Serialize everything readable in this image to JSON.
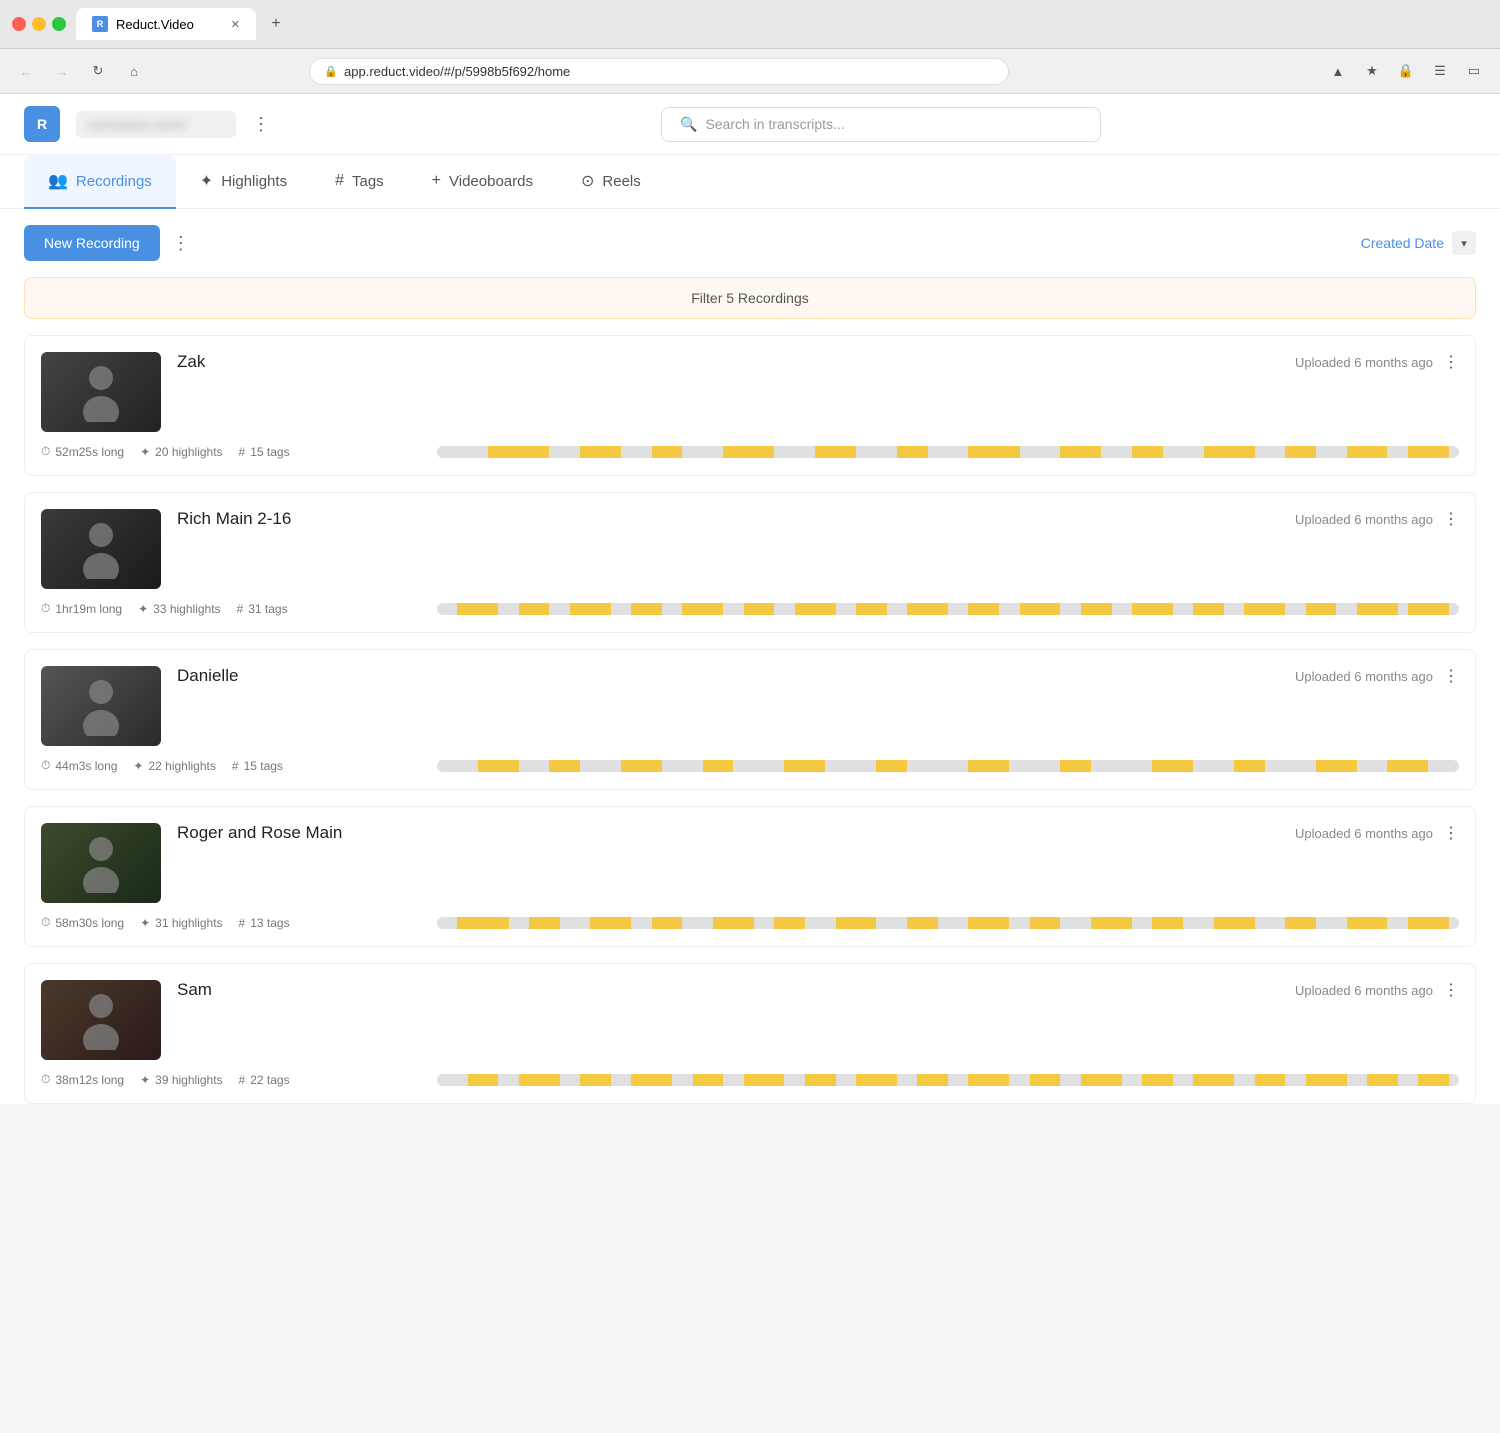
{
  "browser": {
    "url": "app.reduct.video/#/p/5998b5f692/home",
    "tab_title": "Reduct.Video",
    "new_tab_icon": "+"
  },
  "app": {
    "logo_text": "R",
    "workspace_placeholder": "workspace name",
    "more_label": "⋮",
    "search_placeholder": "Search in transcripts..."
  },
  "nav": {
    "tabs": [
      {
        "id": "recordings",
        "icon": "👥",
        "label": "Recordings",
        "active": true
      },
      {
        "id": "highlights",
        "icon": "✦",
        "label": "Highlights",
        "active": false
      },
      {
        "id": "tags",
        "icon": "#",
        "label": "Tags",
        "active": false
      },
      {
        "id": "videoboards",
        "icon": "+",
        "label": "Videoboards",
        "active": false
      },
      {
        "id": "reels",
        "icon": "⊙",
        "label": "Reels",
        "active": false
      }
    ]
  },
  "toolbar": {
    "new_recording_label": "New Recording",
    "sort_label": "Created Date",
    "more_icon": "⋮"
  },
  "filter_bar": {
    "text": "Filter 5 Recordings"
  },
  "recordings": [
    {
      "id": "zak",
      "name": "Zak",
      "upload_time": "Uploaded 6 months ago",
      "duration": "52m25s long",
      "highlights": "20 highlights",
      "tags": "15 tags",
      "thumb_class": "thumb-zak",
      "timeline_segments": [
        {
          "left": "5%",
          "width": "6%",
          "color": "#f5c842"
        },
        {
          "left": "14%",
          "width": "4%",
          "color": "#f5c842"
        },
        {
          "left": "21%",
          "width": "3%",
          "color": "#f5c842"
        },
        {
          "left": "28%",
          "width": "5%",
          "color": "#f5c842"
        },
        {
          "left": "37%",
          "width": "4%",
          "color": "#f5c842"
        },
        {
          "left": "45%",
          "width": "3%",
          "color": "#f5c842"
        },
        {
          "left": "52%",
          "width": "5%",
          "color": "#f5c842"
        },
        {
          "left": "61%",
          "width": "4%",
          "color": "#f5c842"
        },
        {
          "left": "68%",
          "width": "3%",
          "color": "#f5c842"
        },
        {
          "left": "75%",
          "width": "5%",
          "color": "#f5c842"
        },
        {
          "left": "83%",
          "width": "3%",
          "color": "#f5c842"
        },
        {
          "left": "89%",
          "width": "4%",
          "color": "#f5c842"
        },
        {
          "left": "95%",
          "width": "4%",
          "color": "#f5c842"
        }
      ]
    },
    {
      "id": "rich-main",
      "name": "Rich Main 2-16",
      "upload_time": "Uploaded 6 months ago",
      "duration": "1hr19m long",
      "highlights": "33 highlights",
      "tags": "31 tags",
      "thumb_class": "thumb-rich",
      "timeline_segments": [
        {
          "left": "2%",
          "width": "4%",
          "color": "#f5c842"
        },
        {
          "left": "8%",
          "width": "3%",
          "color": "#f5c842"
        },
        {
          "left": "13%",
          "width": "4%",
          "color": "#f5c842"
        },
        {
          "left": "19%",
          "width": "3%",
          "color": "#f5c842"
        },
        {
          "left": "24%",
          "width": "4%",
          "color": "#f5c842"
        },
        {
          "left": "30%",
          "width": "3%",
          "color": "#f5c842"
        },
        {
          "left": "35%",
          "width": "4%",
          "color": "#f5c842"
        },
        {
          "left": "41%",
          "width": "3%",
          "color": "#f5c842"
        },
        {
          "left": "46%",
          "width": "4%",
          "color": "#f5c842"
        },
        {
          "left": "52%",
          "width": "3%",
          "color": "#f5c842"
        },
        {
          "left": "57%",
          "width": "4%",
          "color": "#f5c842"
        },
        {
          "left": "63%",
          "width": "3%",
          "color": "#f5c842"
        },
        {
          "left": "68%",
          "width": "4%",
          "color": "#f5c842"
        },
        {
          "left": "74%",
          "width": "3%",
          "color": "#f5c842"
        },
        {
          "left": "79%",
          "width": "4%",
          "color": "#f5c842"
        },
        {
          "left": "85%",
          "width": "3%",
          "color": "#f5c842"
        },
        {
          "left": "90%",
          "width": "4%",
          "color": "#f5c842"
        },
        {
          "left": "95%",
          "width": "4%",
          "color": "#f5c842"
        }
      ]
    },
    {
      "id": "danielle",
      "name": "Danielle",
      "upload_time": "Uploaded 6 months ago",
      "duration": "44m3s long",
      "highlights": "22 highlights",
      "tags": "15 tags",
      "thumb_class": "thumb-danielle",
      "timeline_segments": [
        {
          "left": "4%",
          "width": "4%",
          "color": "#f5c842"
        },
        {
          "left": "11%",
          "width": "3%",
          "color": "#f5c842"
        },
        {
          "left": "18%",
          "width": "4%",
          "color": "#f5c842"
        },
        {
          "left": "26%",
          "width": "3%",
          "color": "#f5c842"
        },
        {
          "left": "34%",
          "width": "4%",
          "color": "#f5c842"
        },
        {
          "left": "43%",
          "width": "3%",
          "color": "#f5c842"
        },
        {
          "left": "52%",
          "width": "4%",
          "color": "#f5c842"
        },
        {
          "left": "61%",
          "width": "3%",
          "color": "#f5c842"
        },
        {
          "left": "70%",
          "width": "4%",
          "color": "#f5c842"
        },
        {
          "left": "78%",
          "width": "3%",
          "color": "#f5c842"
        },
        {
          "left": "86%",
          "width": "4%",
          "color": "#f5c842"
        },
        {
          "left": "93%",
          "width": "4%",
          "color": "#f5c842"
        }
      ]
    },
    {
      "id": "roger-rose",
      "name": "Roger and Rose Main",
      "upload_time": "Uploaded 6 months ago",
      "duration": "58m30s long",
      "highlights": "31 highlights",
      "tags": "13 tags",
      "thumb_class": "thumb-roger",
      "timeline_segments": [
        {
          "left": "2%",
          "width": "5%",
          "color": "#f5c842"
        },
        {
          "left": "9%",
          "width": "3%",
          "color": "#f5c842"
        },
        {
          "left": "15%",
          "width": "4%",
          "color": "#f5c842"
        },
        {
          "left": "21%",
          "width": "3%",
          "color": "#f5c842"
        },
        {
          "left": "27%",
          "width": "4%",
          "color": "#f5c842"
        },
        {
          "left": "33%",
          "width": "3%",
          "color": "#f5c842"
        },
        {
          "left": "39%",
          "width": "4%",
          "color": "#f5c842"
        },
        {
          "left": "46%",
          "width": "3%",
          "color": "#f5c842"
        },
        {
          "left": "52%",
          "width": "4%",
          "color": "#f5c842"
        },
        {
          "left": "58%",
          "width": "3%",
          "color": "#f5c842"
        },
        {
          "left": "64%",
          "width": "4%",
          "color": "#f5c842"
        },
        {
          "left": "70%",
          "width": "3%",
          "color": "#f5c842"
        },
        {
          "left": "76%",
          "width": "4%",
          "color": "#f5c842"
        },
        {
          "left": "83%",
          "width": "3%",
          "color": "#f5c842"
        },
        {
          "left": "89%",
          "width": "4%",
          "color": "#f5c842"
        },
        {
          "left": "95%",
          "width": "4%",
          "color": "#f5c842"
        }
      ]
    },
    {
      "id": "sam",
      "name": "Sam",
      "upload_time": "Uploaded 6 months ago",
      "duration": "38m12s long",
      "highlights": "39 highlights",
      "tags": "22 tags",
      "thumb_class": "thumb-sam",
      "timeline_segments": [
        {
          "left": "3%",
          "width": "3%",
          "color": "#f5c842"
        },
        {
          "left": "8%",
          "width": "4%",
          "color": "#f5c842"
        },
        {
          "left": "14%",
          "width": "3%",
          "color": "#f5c842"
        },
        {
          "left": "19%",
          "width": "4%",
          "color": "#f5c842"
        },
        {
          "left": "25%",
          "width": "3%",
          "color": "#f5c842"
        },
        {
          "left": "30%",
          "width": "4%",
          "color": "#f5c842"
        },
        {
          "left": "36%",
          "width": "3%",
          "color": "#f5c842"
        },
        {
          "left": "41%",
          "width": "4%",
          "color": "#f5c842"
        },
        {
          "left": "47%",
          "width": "3%",
          "color": "#f5c842"
        },
        {
          "left": "52%",
          "width": "4%",
          "color": "#f5c842"
        },
        {
          "left": "58%",
          "width": "3%",
          "color": "#f5c842"
        },
        {
          "left": "63%",
          "width": "4%",
          "color": "#f5c842"
        },
        {
          "left": "69%",
          "width": "3%",
          "color": "#f5c842"
        },
        {
          "left": "74%",
          "width": "4%",
          "color": "#f5c842"
        },
        {
          "left": "80%",
          "width": "3%",
          "color": "#f5c842"
        },
        {
          "left": "85%",
          "width": "4%",
          "color": "#f5c842"
        },
        {
          "left": "91%",
          "width": "3%",
          "color": "#f5c842"
        },
        {
          "left": "96%",
          "width": "3%",
          "color": "#f5c842"
        }
      ]
    }
  ],
  "colors": {
    "accent": "#4a90e2",
    "highlight_yellow": "#f5c842",
    "timeline_bg": "#e0e0e0"
  }
}
